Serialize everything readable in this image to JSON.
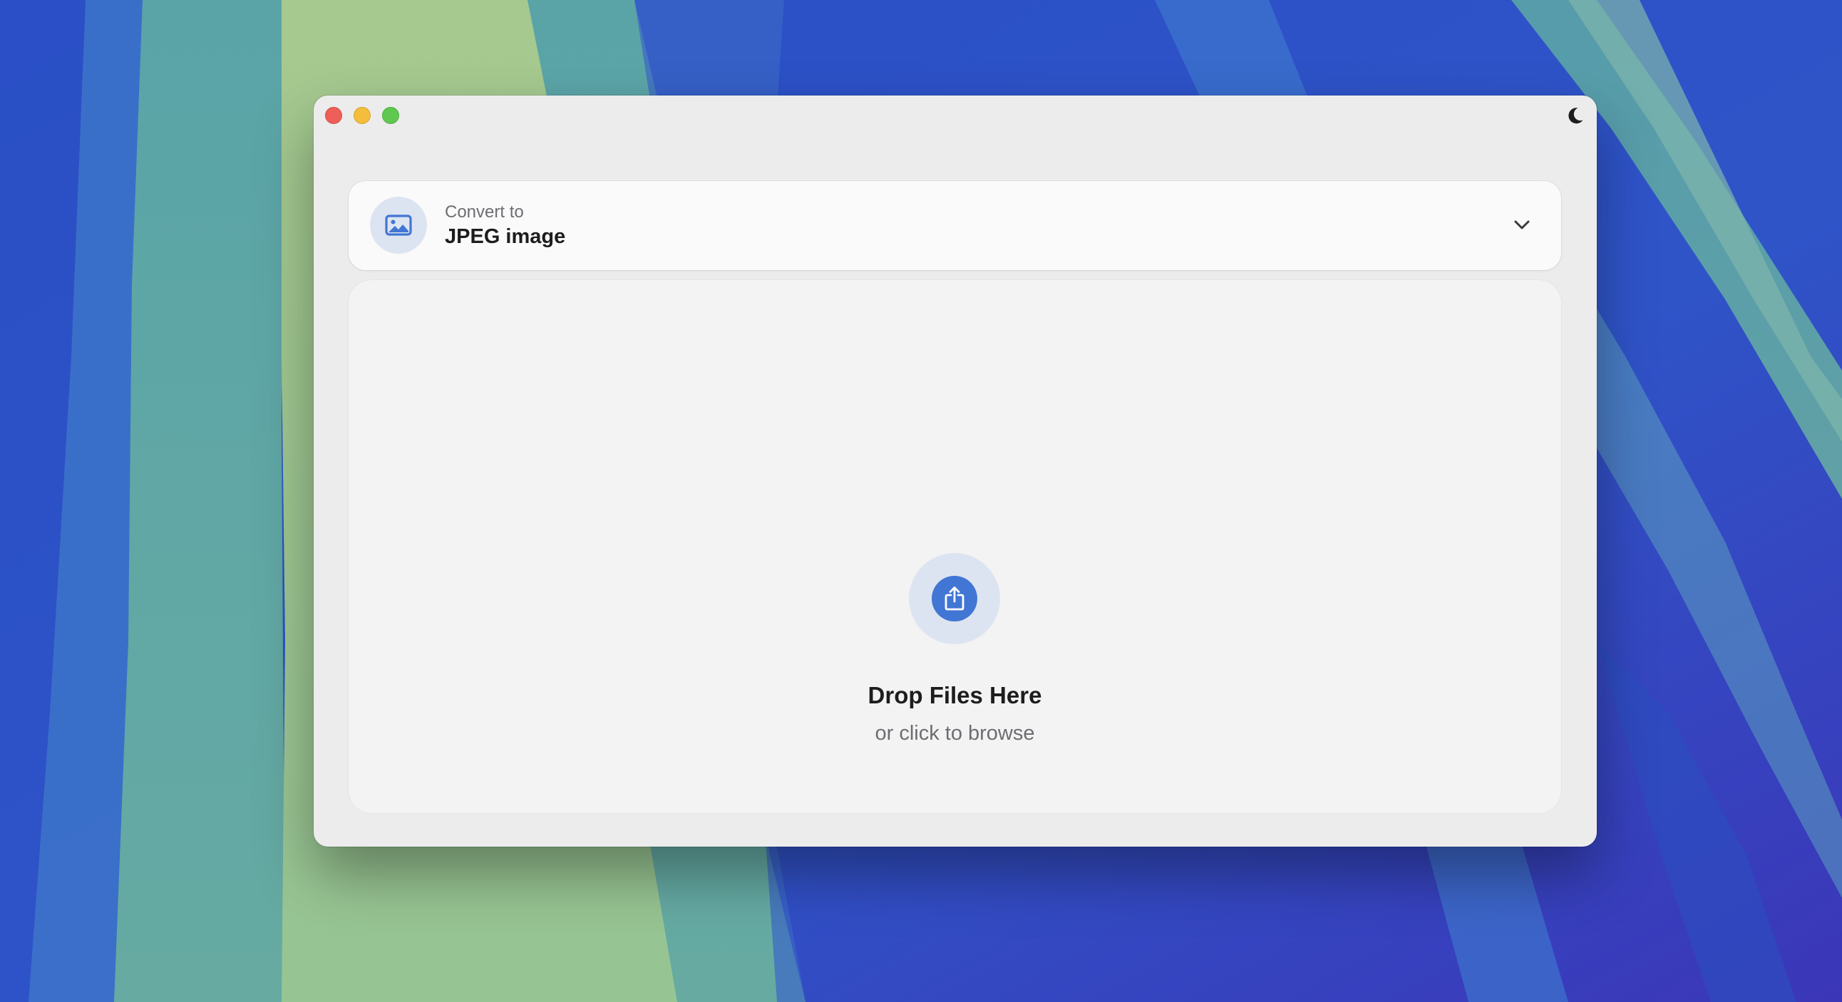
{
  "window": {
    "controls": [
      "close",
      "minimize",
      "zoom"
    ],
    "theme_toggle_icon": "moon-icon"
  },
  "converter": {
    "label": "Convert to",
    "selected_format": "JPEG image",
    "format_icon": "image-icon",
    "dropdown_icon": "chevron-down-icon"
  },
  "drop_zone": {
    "icon": "share-upload-icon",
    "title": "Drop Files Here",
    "subtitle": "or click to browse"
  },
  "colors": {
    "accent": "#4176d4",
    "accent_light": "#dde4f1",
    "close": "#ed5f57",
    "minimize": "#f4bd3b",
    "zoom": "#5fc84e"
  }
}
